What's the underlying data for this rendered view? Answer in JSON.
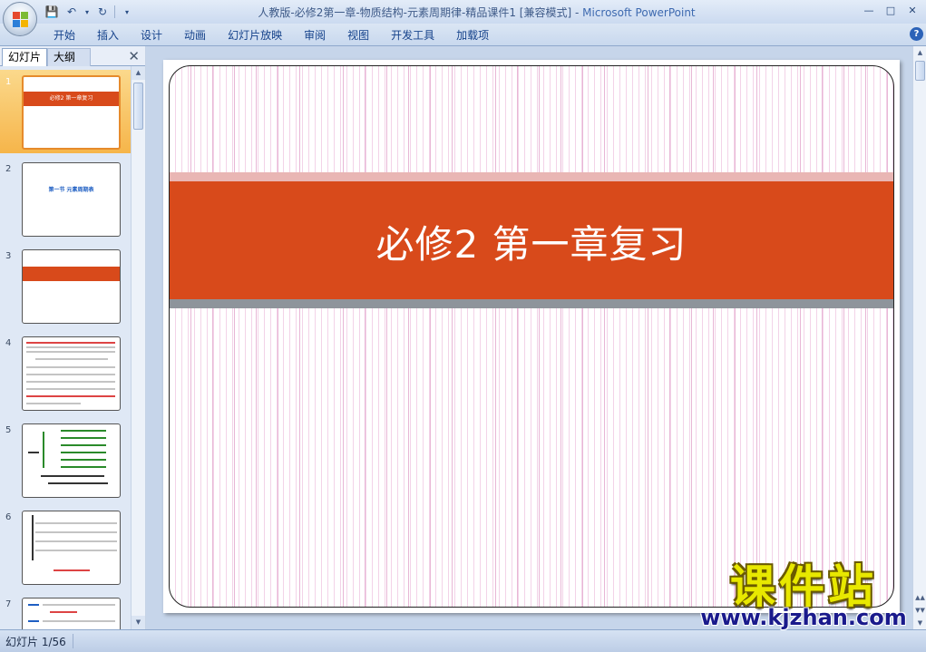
{
  "window": {
    "title_doc": "人教版-必修2第一章-物质结构-元素周期律-精品课件1 [兼容模式]",
    "title_sep": " - ",
    "title_app": "Microsoft PowerPoint"
  },
  "ribbon": {
    "tabs": [
      "开始",
      "插入",
      "设计",
      "动画",
      "幻灯片放映",
      "审阅",
      "视图",
      "开发工具",
      "加载项"
    ]
  },
  "left_panel": {
    "tab_slides": "幻灯片",
    "tab_outline": "大纲",
    "slides": [
      {
        "num": "1",
        "text": "必修2 第一章复习",
        "selected": true
      },
      {
        "num": "2",
        "text": "第一节  元素周期表",
        "selected": false
      },
      {
        "num": "3",
        "text": "",
        "selected": false
      },
      {
        "num": "4",
        "text": "",
        "selected": false
      },
      {
        "num": "5",
        "text": "",
        "selected": false
      },
      {
        "num": "6",
        "text": "",
        "selected": false
      },
      {
        "num": "7",
        "text": "",
        "selected": false
      }
    ]
  },
  "slide": {
    "title": "必修2 第一章复习"
  },
  "watermark": {
    "cn": "课件站",
    "url": "www.kjzhan.com"
  },
  "status_bar": {
    "slide_counter": "幻灯片 1/56"
  },
  "colors": {
    "title_band": "#d84a1b",
    "selected_thumb": "#f6b54a"
  }
}
